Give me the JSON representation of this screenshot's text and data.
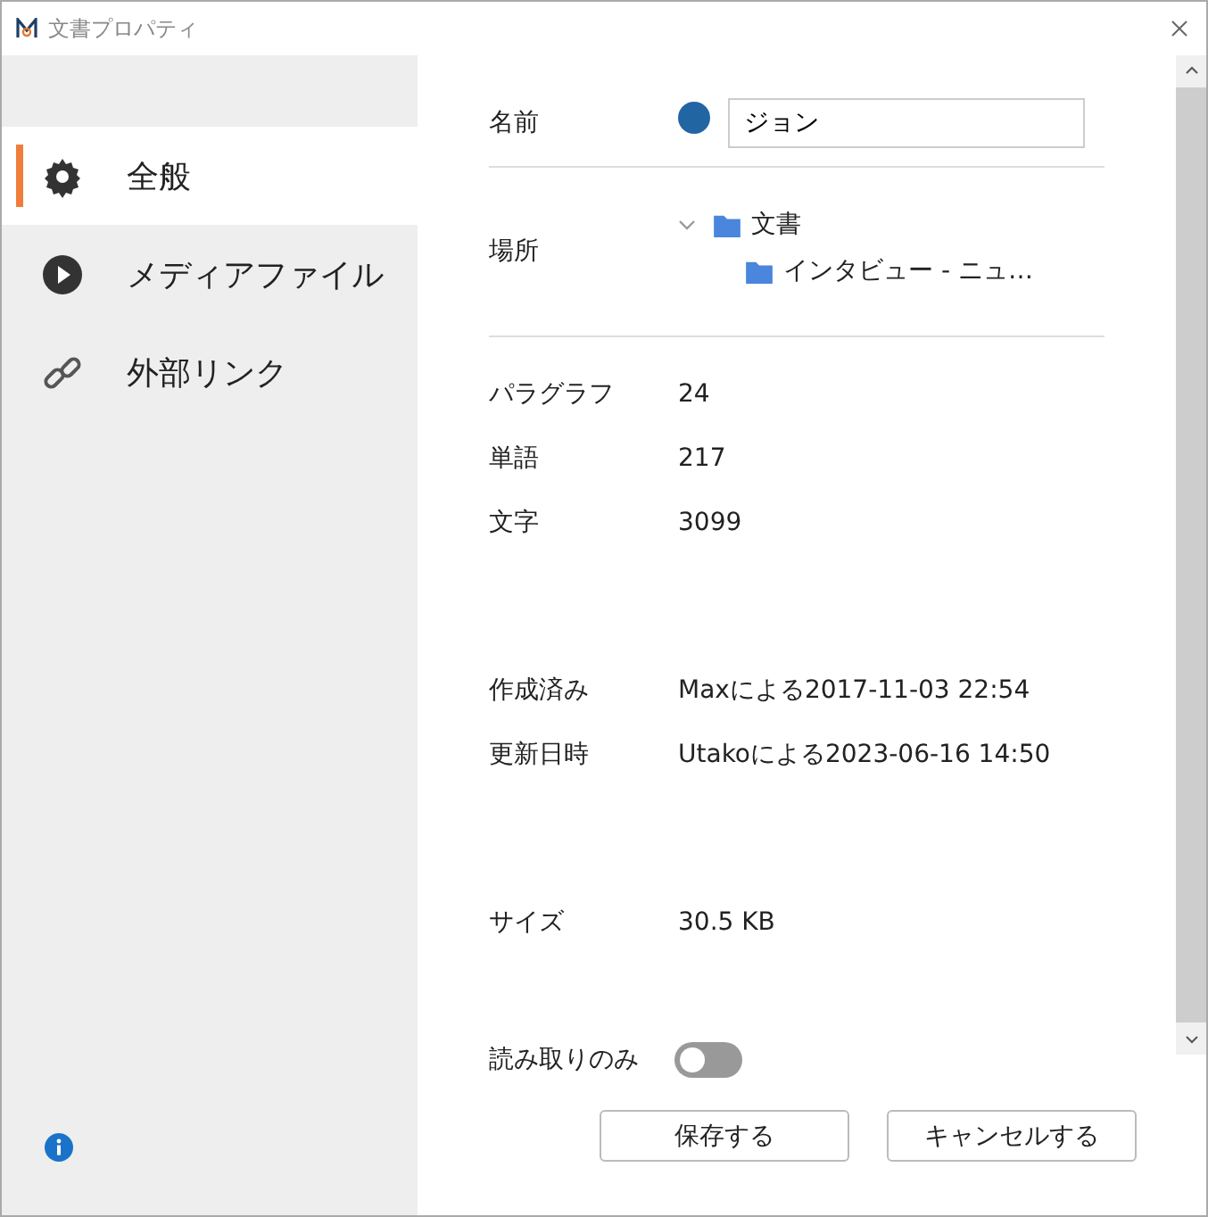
{
  "window": {
    "title": "文書プロパティ"
  },
  "sidebar": {
    "items": [
      {
        "label": "全般",
        "kind": "gear",
        "selected": true
      },
      {
        "label": "メディアファイル",
        "kind": "play",
        "selected": false
      },
      {
        "label": "外部リンク",
        "kind": "link",
        "selected": false
      }
    ]
  },
  "name": {
    "label": "名前",
    "color": "#2265a3",
    "value": "ジョン"
  },
  "location": {
    "label": "場所",
    "tree": [
      {
        "label": "文書",
        "expanded": true,
        "children": [
          {
            "label": "インタビュー - ニュ…"
          }
        ]
      }
    ]
  },
  "groups": [
    [
      {
        "label": "パラグラフ",
        "value": "24"
      },
      {
        "label": "単語",
        "value": "217"
      },
      {
        "label": "文字",
        "value": "3099"
      }
    ],
    [
      {
        "label": "作成済み",
        "value": "Maxによる2017-11-03 22:54"
      },
      {
        "label": "更新日時",
        "value": "Utakoによる2023-06-16 14:50"
      }
    ],
    [
      {
        "label": "サイズ",
        "value": "30.5 KB"
      }
    ]
  ],
  "readonly": {
    "label": "読み取りのみ",
    "on": false
  },
  "buttons": [
    "保存する",
    "キャンセルする"
  ]
}
